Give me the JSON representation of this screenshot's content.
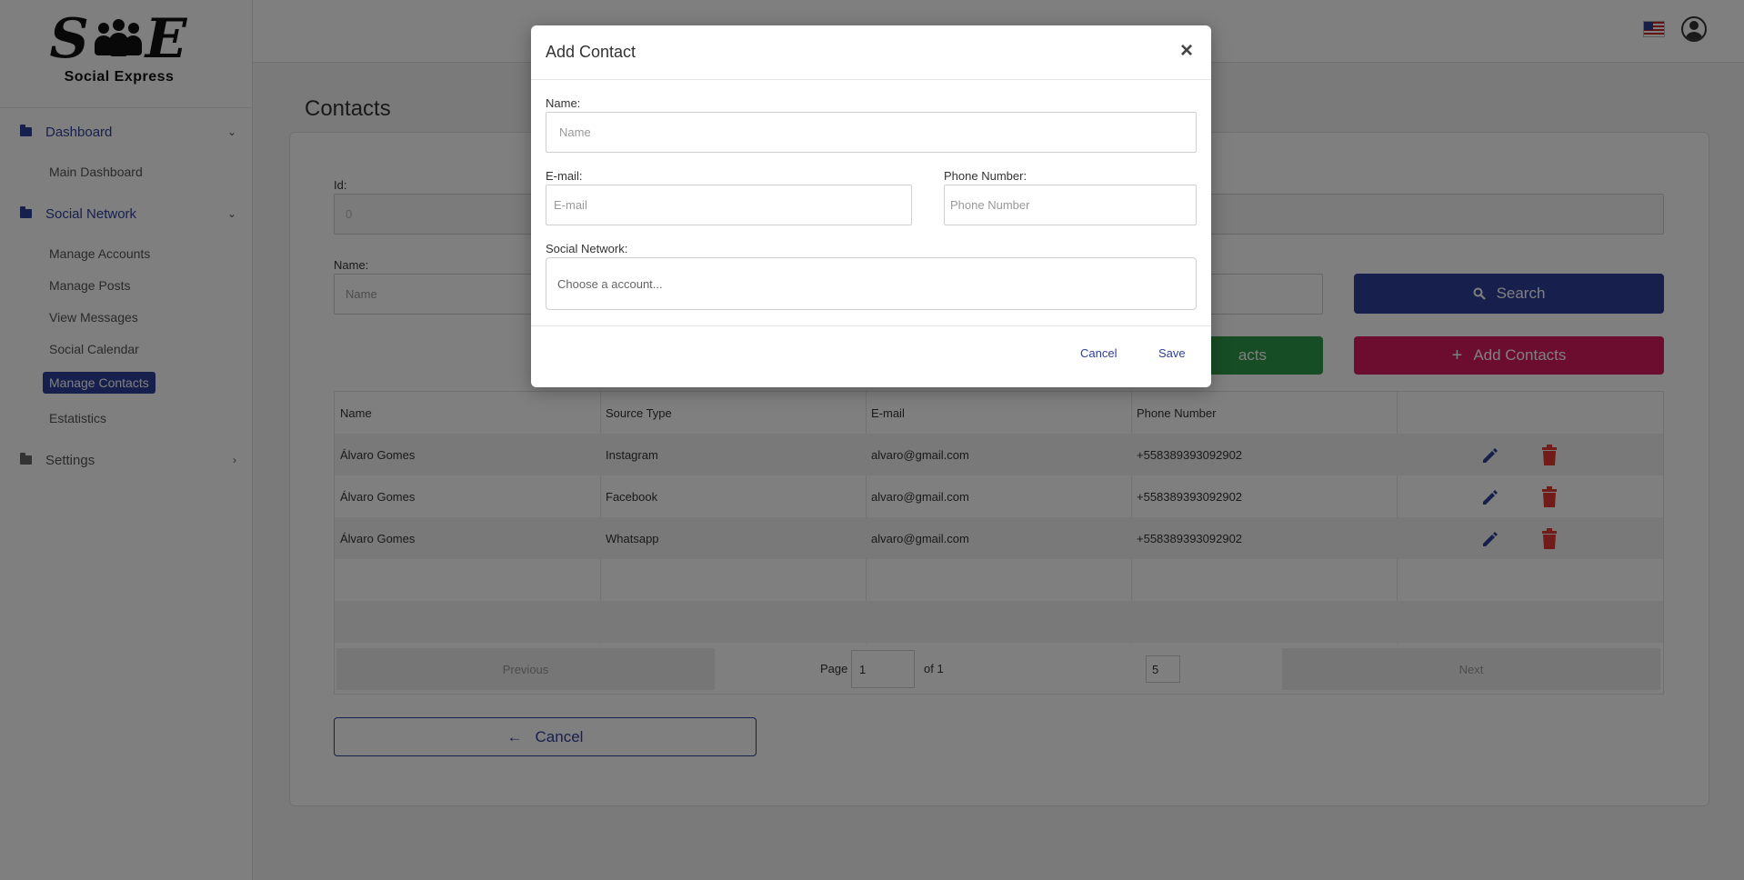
{
  "brand": {
    "logo_letters": [
      "S",
      "E"
    ],
    "name": "Social Express"
  },
  "sidebar": {
    "groups": [
      {
        "label": "Dashboard",
        "items": [
          "Main Dashboard"
        ]
      },
      {
        "label": "Social Network",
        "items": [
          "Manage Accounts",
          "Manage Posts",
          "View Messages",
          "Social Calendar",
          "Manage Contacts",
          "Estatistics"
        ]
      },
      {
        "label": "Settings",
        "items": []
      }
    ],
    "active_item": "Manage Contacts"
  },
  "page": {
    "title": "Contacts"
  },
  "filters": {
    "id_label": "Id:",
    "id_placeholder": "0",
    "name_label": "Name:",
    "name_placeholder": "Name",
    "search_label": "Search",
    "contacts_btn_partial": "acts",
    "add_contacts_label": "Add Contacts"
  },
  "table": {
    "headers": [
      "Name",
      "Source Type",
      "E-mail",
      "Phone Number"
    ],
    "rows": [
      {
        "name": "Álvaro Gomes",
        "source": "Instagram",
        "email": "alvaro@gmail.com",
        "phone": "+558389393092902"
      },
      {
        "name": "Álvaro Gomes",
        "source": "Facebook",
        "email": "alvaro@gmail.com",
        "phone": "+558389393092902"
      },
      {
        "name": "Álvaro Gomes",
        "source": "Whatsapp",
        "email": "alvaro@gmail.com",
        "phone": "+558389393092902"
      }
    ],
    "pager": {
      "previous": "Previous",
      "page_label": "Page",
      "page_value": "1",
      "of_label": "of 1",
      "page_size": "5",
      "next": "Next"
    }
  },
  "cancel_button": "Cancel",
  "modal": {
    "title": "Add Contact",
    "close": "×",
    "name_label": "Name:",
    "name_placeholder": "Name",
    "email_label": "E-mail:",
    "email_placeholder": "E-mail",
    "phone_label": "Phone Number:",
    "phone_placeholder": "Phone Number",
    "social_label": "Social Network:",
    "social_placeholder": "Choose a account...",
    "cancel": "Cancel",
    "save": "Save"
  },
  "colors": {
    "primary": "#2e3f9b",
    "success": "#2e9a48",
    "accent": "#d81b60",
    "danger": "#e53935"
  }
}
